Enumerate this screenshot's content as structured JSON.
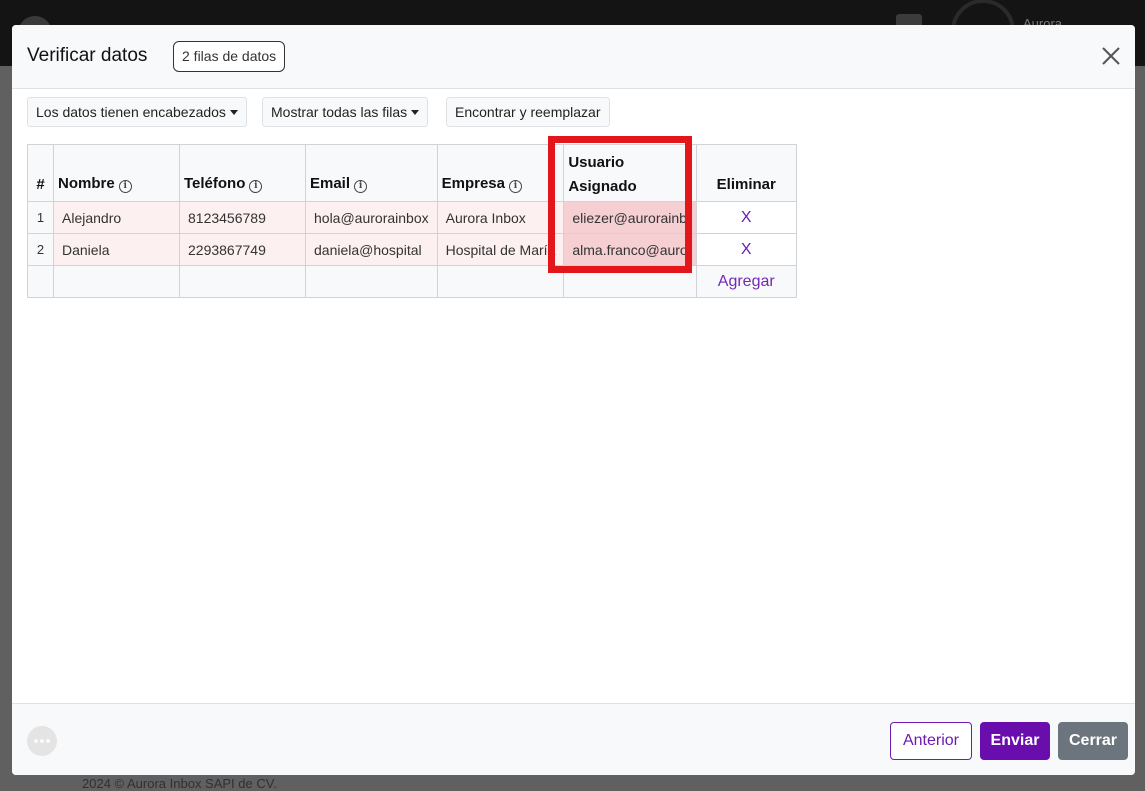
{
  "background": {
    "user_name": "Aurora",
    "footer_text": "2024 © Aurora Inbox SAPI de CV."
  },
  "modal": {
    "title": "Verificar datos",
    "rows_badge": "2 filas de datos",
    "close_icon": "close-x-icon"
  },
  "toolbar": {
    "headers_dropdown": "Los datos tienen encabezados",
    "rows_dropdown": "Mostrar todas las filas",
    "find_replace": "Encontrar y reemplazar"
  },
  "table": {
    "columns": {
      "num": "#",
      "nombre": "Nombre",
      "telefono": "Teléfono",
      "email": "Email",
      "empresa": "Empresa",
      "usuario_line1": "Usuario",
      "usuario_line2": "Asignado",
      "eliminar": "Eliminar"
    },
    "info_icon": "info-circle-icon",
    "rows": [
      {
        "num": "1",
        "nombre": "Alejandro",
        "telefono": "8123456789",
        "email": "hola@aurorainbox",
        "empresa": "Aurora Inbox",
        "usuario": "eliezer@aurorainb",
        "delete": "X"
      },
      {
        "num": "2",
        "nombre": "Daniela",
        "telefono": "2293867749",
        "email": "daniela@hospital",
        "empresa": "Hospital de María",
        "usuario": "alma.franco@auro",
        "delete": "X"
      }
    ],
    "add_label": "Agregar"
  },
  "colors": {
    "accent": "#6a0dad",
    "highlight_border": "#e3161c",
    "secondary": "#6c757d"
  },
  "footer": {
    "anterior": "Anterior",
    "enviar": "Enviar",
    "cerrar": "Cerrar"
  }
}
